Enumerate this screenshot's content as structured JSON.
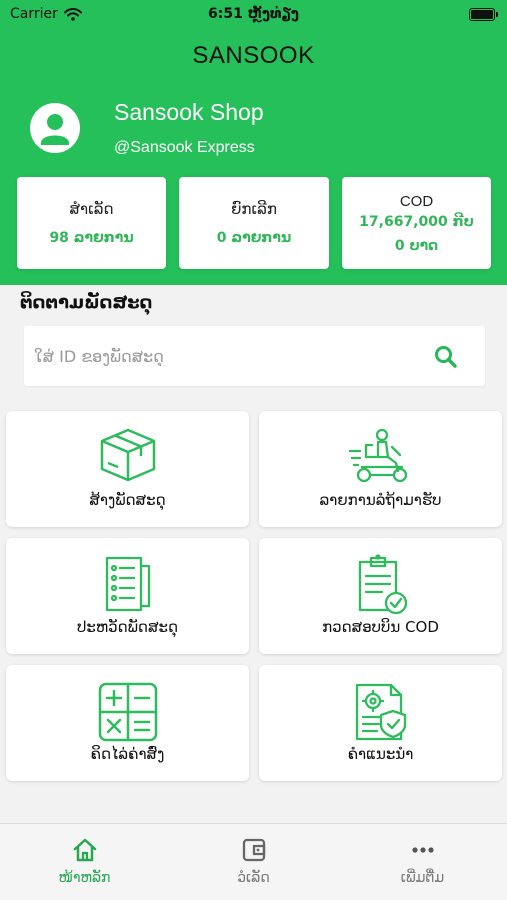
{
  "status_bar": {
    "carrier": "Carrier",
    "time": "6:51 ຫຼັງທ່ຽງ"
  },
  "header": {
    "title": "SANSOOK"
  },
  "profile": {
    "name": "Sansook Shop",
    "handle": "@Sansook Express"
  },
  "stats": [
    {
      "label": "ສຳເລັດ",
      "value": "98 ລາຍການ"
    },
    {
      "label": "ຍົກເລີກ",
      "value": "0 ລາຍການ"
    },
    {
      "label": "COD",
      "value": "17,667,000 ກີບ",
      "value2": "0 ບາດ"
    }
  ],
  "tracking": {
    "title": "ຕິດຕາມພັດສະດຸ",
    "placeholder": "ໃສ່ ID ຂອງພັດສະດຸ",
    "value": ""
  },
  "menu": [
    {
      "label": "ສ້າງພັດສະດຸ",
      "icon": "box-icon"
    },
    {
      "label": "ລາຍການລໍຖ້າມາຮັບ",
      "icon": "delivery-scooter-icon"
    },
    {
      "label": "ປະຫວັດພັດສະດຸ",
      "icon": "history-list-icon"
    },
    {
      "label": "ກວດສອບບິນ COD",
      "icon": "clipboard-check-icon"
    },
    {
      "label": "ຄິດໄລ່ຄ່າສົ່ງ",
      "icon": "calculator-icon"
    },
    {
      "label": "ຄຳແນະນຳ",
      "icon": "guide-document-icon"
    }
  ],
  "tabs": [
    {
      "label": "ໜ້າຫລັກ",
      "icon": "home-icon",
      "active": true
    },
    {
      "label": "ວໍເລັດ",
      "icon": "wallet-icon",
      "active": false
    },
    {
      "label": "ເພີ່ມຕື່ມ",
      "icon": "more-dots-icon",
      "active": false
    }
  ],
  "colors": {
    "brand_green": "#25c05a",
    "value_green": "#33b559",
    "icon_green": "#2dbb5c",
    "active_tab": "#25a850"
  }
}
